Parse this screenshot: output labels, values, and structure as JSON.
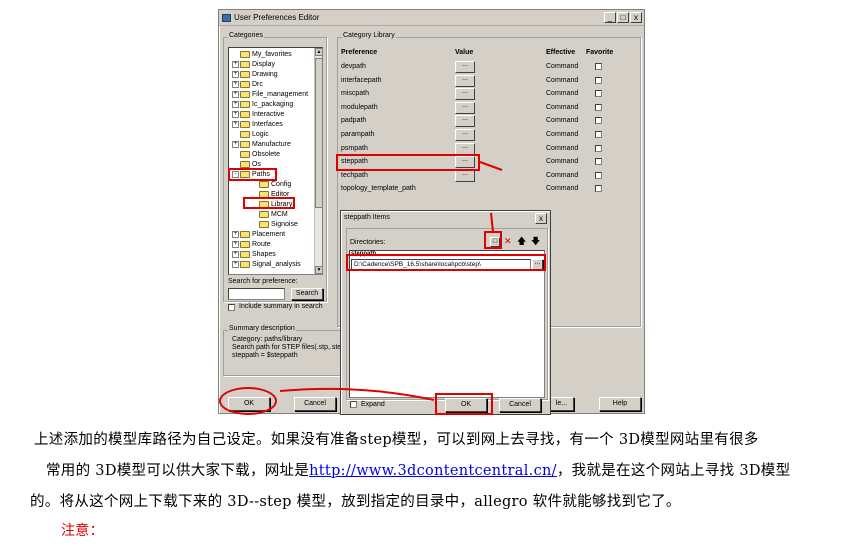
{
  "window": {
    "title": "User Preferences Editor",
    "controls": [
      "_",
      "□",
      "x"
    ],
    "categories_label": "Categories",
    "tree": [
      {
        "label": "My_favorites",
        "exp": false,
        "level": 0
      },
      {
        "label": "Display",
        "exp": true,
        "level": 0
      },
      {
        "label": "Drawing",
        "exp": true,
        "level": 0
      },
      {
        "label": "Drc",
        "exp": true,
        "level": 0
      },
      {
        "label": "File_management",
        "exp": true,
        "level": 0
      },
      {
        "label": "Ic_packaging",
        "exp": true,
        "level": 0
      },
      {
        "label": "Interactive",
        "exp": true,
        "level": 0
      },
      {
        "label": "Interfaces",
        "exp": true,
        "level": 0
      },
      {
        "label": "Logic",
        "exp": false,
        "level": 0
      },
      {
        "label": "Manufacture",
        "exp": true,
        "level": 0
      },
      {
        "label": "Obsolete",
        "exp": false,
        "level": 0
      },
      {
        "label": "Os",
        "exp": false,
        "level": 0
      },
      {
        "label": "Paths",
        "exp": true,
        "level": 0
      },
      {
        "label": "Config",
        "exp": false,
        "level": 1
      },
      {
        "label": "Editor",
        "exp": false,
        "level": 1
      },
      {
        "label": "Library",
        "exp": false,
        "level": 1
      },
      {
        "label": "MCM",
        "exp": false,
        "level": 1
      },
      {
        "label": "Signoise",
        "exp": false,
        "level": 1
      },
      {
        "label": "Placement",
        "exp": true,
        "level": 0
      },
      {
        "label": "Route",
        "exp": true,
        "level": 0
      },
      {
        "label": "Shapes",
        "exp": true,
        "level": 0
      },
      {
        "label": "Signal_analysis",
        "exp": true,
        "level": 0
      }
    ],
    "tree_expanders": {
      "collapsed": "+",
      "expanded": "-"
    },
    "search_label": "Search for preference:",
    "search_value": "",
    "search_button": "Search",
    "include_summary": "Include summary in search",
    "summary_label": "Summary description",
    "summary_lines": [
      "Category: paths/library",
      "Search path for STEP files(.stp,.step)",
      "steppath = $steppath"
    ],
    "category_header": "Category  Library",
    "col_preference": "Preference",
    "col_value": "Value",
    "col_effective": "Effective",
    "col_favorite": "Favorite",
    "rows": [
      {
        "pref": "devpath",
        "eff": "Command"
      },
      {
        "pref": "interfacepath",
        "eff": "Command"
      },
      {
        "pref": "miscpath",
        "eff": "Command"
      },
      {
        "pref": "modulepath",
        "eff": "Command"
      },
      {
        "pref": "padpath",
        "eff": "Command"
      },
      {
        "pref": "parampath",
        "eff": "Command"
      },
      {
        "pref": "psmpath",
        "eff": "Command"
      },
      {
        "pref": "steppath",
        "eff": "Command"
      },
      {
        "pref": "techpath",
        "eff": "Command"
      },
      {
        "pref": "topology_template_path",
        "eff": "Command"
      }
    ],
    "value_button": "...",
    "ok": "OK",
    "cancel": "Cancel",
    "help_partial": "le...",
    "help": "Help"
  },
  "dialog": {
    "title": "steppath Items",
    "close": "x",
    "directories_label": "Directories:",
    "new_icon": "□",
    "delete_icon": "✕",
    "up_icon": "🡅",
    "down_icon": "🡇",
    "list_header": "steppath",
    "entry_value": "D:\\Cadence\\SPB_16.5\\share\\local\\pcb\\step\\",
    "browse": "...",
    "expand": "Expand",
    "ok": "OK",
    "cancel": "Cancel"
  },
  "caption": {
    "line1": "上述添加的模型库路径为自己设定。如果没有准备step模型，可以到网上去寻找，有一个 3D模型网站里有很多",
    "line2_pre": "常用的 3D模型可以供大家下载，网址是",
    "line2_link": "http://www.3dcontentcentral.cn/",
    "line2_post": "，我就是在这个网站上寻找 3D模型",
    "line3": "的。将从这个网上下载下来的 3D--step 模型，放到指定的目录中，allegro 软件就能够找到它了。",
    "note": "注意："
  },
  "colors": {
    "annotation": "#e00000",
    "link": "#0000ee",
    "window_bg": "#d4d0c8"
  }
}
